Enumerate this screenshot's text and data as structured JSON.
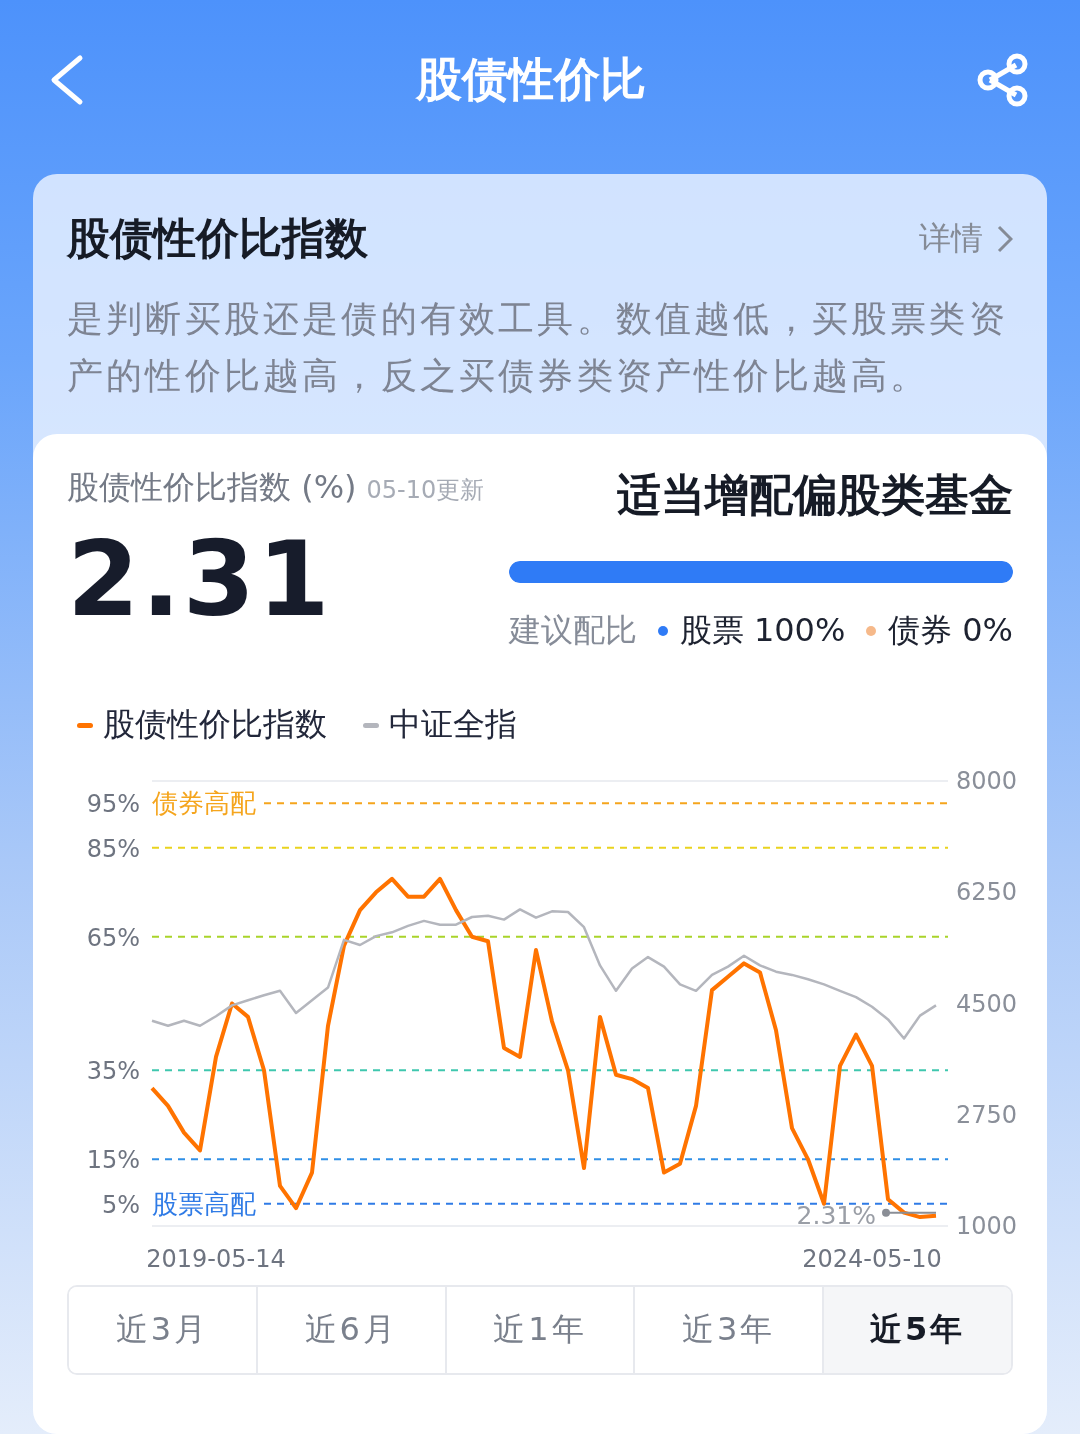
{
  "header": {
    "title": "股债性价比"
  },
  "intro": {
    "title": "股债性价比指数",
    "details_link": "详情",
    "description": "是判断买股还是债的有效工具。数值越低，买股票类资产的性价比越高，反之买债券类资产性价比越高。"
  },
  "index_card": {
    "label": "股债性价比指数 (%)",
    "updated": "05-10更新",
    "value": "2.31",
    "advice": "适当增配偏股类基金"
  },
  "allocation": {
    "label": "建议配比",
    "level": 1,
    "items": [
      {
        "name": "股票",
        "value": "100%",
        "color": "#2f7bf6"
      },
      {
        "name": "债券",
        "value": "0%",
        "color": "#f6b98a"
      }
    ]
  },
  "chart_data": {
    "type": "line",
    "categories": [
      null,
      null,
      null,
      null,
      "2019-05-14",
      null,
      null,
      null,
      null,
      null,
      null,
      null,
      null,
      null,
      null,
      null,
      null,
      null,
      null,
      null,
      null,
      null,
      null,
      null,
      null,
      null,
      null,
      null,
      null,
      null,
      null,
      null,
      null,
      null,
      null,
      null,
      null,
      null,
      null,
      null,
      null,
      null,
      null,
      null,
      null,
      "2024-05-10",
      null,
      null,
      null,
      null
    ],
    "ylim": [
      0,
      100
    ],
    "y2lim": [
      1000,
      8000
    ],
    "yticks": [
      {
        "value": 95,
        "label": "95%"
      },
      {
        "value": 85,
        "label": "85%"
      },
      {
        "value": 65,
        "label": "65%"
      },
      {
        "value": 35,
        "label": "35%"
      },
      {
        "value": 15,
        "label": "15%"
      },
      {
        "value": 5,
        "label": "5%"
      }
    ],
    "y2ticks": [
      8000,
      6250,
      4500,
      2750,
      1000
    ],
    "series": [
      {
        "name": "股债性价比指数",
        "color": "#ff7300",
        "values": [
          31,
          27,
          21,
          17,
          38,
          50,
          47,
          35,
          9,
          4,
          12,
          45,
          63,
          71,
          75,
          78,
          74,
          74,
          78,
          71,
          65,
          64,
          40,
          38,
          62,
          46,
          35,
          13,
          47,
          34,
          33,
          31,
          12,
          14,
          27,
          53,
          56,
          59,
          57,
          44,
          22,
          15,
          5,
          36,
          43,
          36,
          6,
          3,
          2,
          2.3
        ]
      },
      {
        "name": "中证全指",
        "color": "#b4b6bd",
        "axis": "y2",
        "values": [
          4230,
          4150,
          4230,
          4150,
          4300,
          4470,
          4550,
          4630,
          4700,
          4350,
          4550,
          4750,
          5500,
          5420,
          5560,
          5620,
          5720,
          5800,
          5740,
          5740,
          5860,
          5880,
          5820,
          5980,
          5850,
          5950,
          5940,
          5700,
          5100,
          4700,
          5050,
          5230,
          5080,
          4800,
          4700,
          4950,
          5080,
          5250,
          5100,
          5000,
          4950,
          4880,
          4800,
          4700,
          4600,
          4450,
          4250,
          3950,
          4310,
          4470
        ]
      }
    ],
    "ref_lines": [
      {
        "axis": "y",
        "value": 95,
        "color": "#f5a51d",
        "label": "债券高配"
      },
      {
        "axis": "y",
        "value": 85,
        "color": "#e9d31e"
      },
      {
        "axis": "y",
        "value": 65,
        "color": "#a9d42a"
      },
      {
        "axis": "y",
        "value": 35,
        "color": "#3fc7ae"
      },
      {
        "axis": "y",
        "value": 15,
        "color": "#2f8fe6"
      },
      {
        "axis": "y",
        "value": 5,
        "color": "#2f7be6",
        "label": "股票高配"
      }
    ],
    "annotations": [
      {
        "text": "2.31%"
      }
    ]
  },
  "tabs": [
    {
      "label": "近3月",
      "selected": false
    },
    {
      "label": "近6月",
      "selected": false
    },
    {
      "label": "近1年",
      "selected": false
    },
    {
      "label": "近3年",
      "selected": false
    },
    {
      "label": "近5年",
      "selected": true
    }
  ]
}
